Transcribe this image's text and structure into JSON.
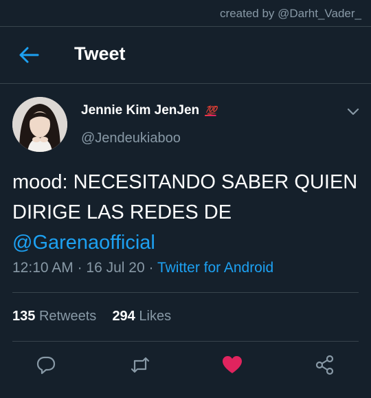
{
  "credit": "created by @Darht_Vader_",
  "header": {
    "title": "Tweet"
  },
  "user": {
    "display_name": "Jennie Kim JenJen",
    "badge": "💯",
    "handle": "@Jendeukiaboo"
  },
  "tweet": {
    "text": "mood: NECESITANDO SABER QUIEN DIRIGE LAS REDES DE",
    "mention": "@Garenaofficial",
    "time": "12:10 AM",
    "date": "16 Jul 20",
    "source": "Twitter for Android",
    "separator": "·"
  },
  "stats": {
    "retweets_count": "135",
    "retweets_label": "Retweets",
    "likes_count": "294",
    "likes_label": "Likes"
  },
  "colors": {
    "background": "#15202b",
    "accent": "#1da1f2",
    "muted": "#8899a6",
    "like": "#e0245e",
    "divider": "#38444d"
  },
  "icons": [
    "back-arrow-icon",
    "chevron-down-icon",
    "reply-icon",
    "retweet-icon",
    "heart-icon",
    "share-icon"
  ]
}
